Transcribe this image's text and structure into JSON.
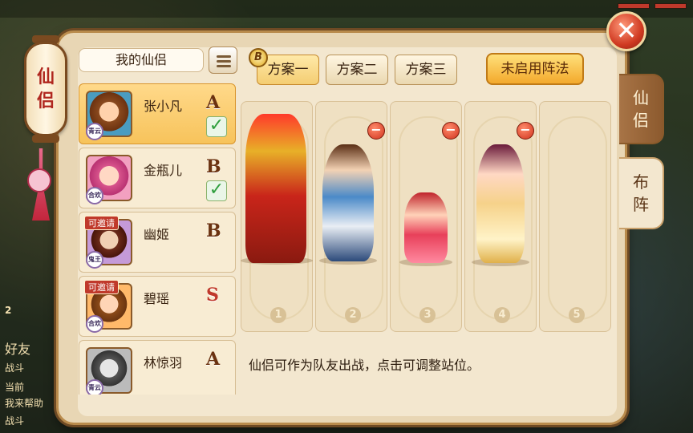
{
  "window": {
    "close_icon": "close-icon"
  },
  "lantern": {
    "title_chars": [
      "仙",
      "侣"
    ]
  },
  "side_tabs": [
    {
      "label": "仙侣",
      "chars": [
        "仙",
        "侣"
      ],
      "active": false
    },
    {
      "label": "布阵",
      "chars": [
        "布",
        "阵"
      ],
      "active": true
    }
  ],
  "list": {
    "header": "我的仙侣",
    "menu_icon": "list-menu-icon",
    "items": [
      {
        "name": "张小凡",
        "grade": "A",
        "relation": "青云",
        "selected": true,
        "checked": true,
        "invite": ""
      },
      {
        "name": "金瓶儿",
        "grade": "B",
        "relation": "合欢",
        "selected": false,
        "checked": true,
        "invite": ""
      },
      {
        "name": "幽姬",
        "grade": "B",
        "relation": "鬼王",
        "selected": false,
        "checked": false,
        "invite": "可邀请"
      },
      {
        "name": "碧瑶",
        "grade": "S",
        "relation": "合欢",
        "selected": false,
        "checked": false,
        "invite": "可邀请"
      },
      {
        "name": "林惊羽",
        "grade": "A",
        "relation": "青云",
        "selected": false,
        "checked": false,
        "invite": ""
      }
    ]
  },
  "schemes": {
    "badge": "B",
    "tabs": [
      "方案一",
      "方案二",
      "方案三"
    ],
    "active_index": 0
  },
  "formation_button": "未启用阵法",
  "slots": {
    "numbers": [
      "1",
      "2",
      "3",
      "4",
      "5"
    ],
    "filled": [
      true,
      true,
      true,
      true,
      false
    ],
    "removable": [
      false,
      true,
      true,
      true,
      false
    ]
  },
  "hint": "仙侣可作为队友出战，点击可调整站位。",
  "chat_remnant": {
    "friends": "好友",
    "lines": [
      "战斗",
      "当前",
      "我来帮助",
      "战斗"
    ],
    "badge": "2"
  }
}
